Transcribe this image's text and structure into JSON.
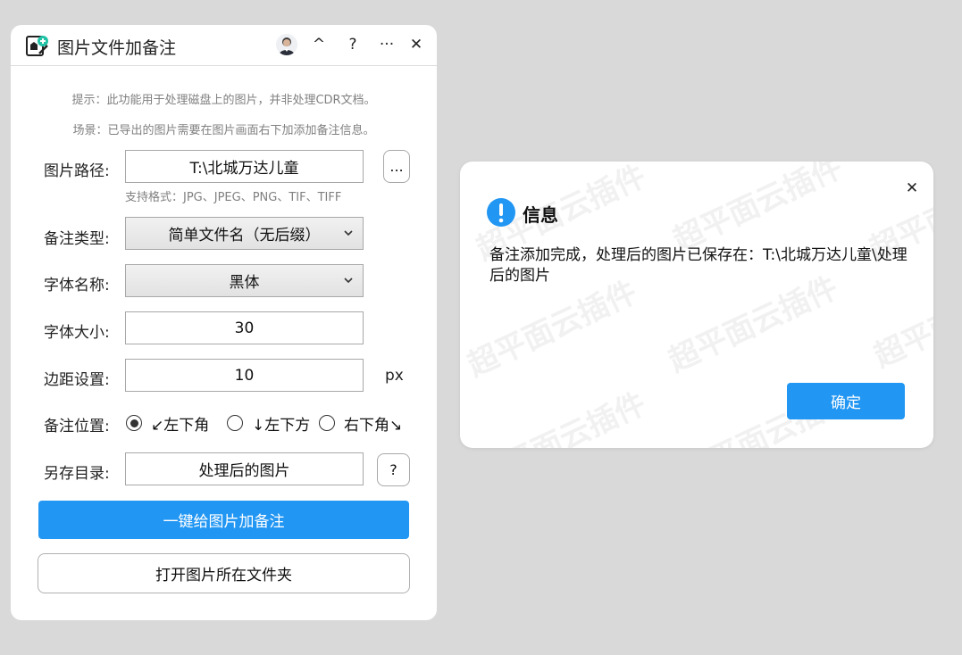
{
  "app": {
    "title": "图片文件加备注",
    "titlebar_buttons": {
      "collapse": "^",
      "help": "?",
      "more": "···",
      "close": "✕"
    }
  },
  "hints": {
    "tip": "提示：此功能用于处理磁盘上的图片，并非处理CDR文档。",
    "scene": "场景：已导出的图片需要在图片画面右下加添加备注信息。"
  },
  "form": {
    "image_path": {
      "label": "图片路径:",
      "value": "T:\\北城万达儿童",
      "browse_label": "...",
      "formats": "支持格式：JPG、JPEG、PNG、TIF、TIFF"
    },
    "note_type": {
      "label": "备注类型:",
      "selected": "简单文件名（无后缀）"
    },
    "font_name": {
      "label": "字体名称:",
      "selected": "黑体"
    },
    "font_size": {
      "label": "字体大小:",
      "value": "30"
    },
    "margin": {
      "label": "边距设置:",
      "value": "10",
      "unit": "px"
    },
    "position": {
      "label": "备注位置:",
      "options": [
        {
          "label": "↙左下角",
          "selected": true
        },
        {
          "label": "↓左下方",
          "selected": false
        },
        {
          "label": "右下角↘",
          "selected": false
        }
      ]
    },
    "save_dir": {
      "label": "另存目录:",
      "value": "处理后的图片",
      "help_label": "?"
    }
  },
  "actions": {
    "primary": "一键给图片加备注",
    "open_folder": "打开图片所在文件夹"
  },
  "dialog": {
    "title": "信息",
    "message": "备注添加完成，处理后的图片已保存在：T:\\北城万达儿童\\处理后的图片",
    "ok": "确定",
    "close": "✕",
    "watermark": "超平面云插件"
  },
  "colors": {
    "accent": "#2196f3",
    "background": "#d9d9d9"
  }
}
